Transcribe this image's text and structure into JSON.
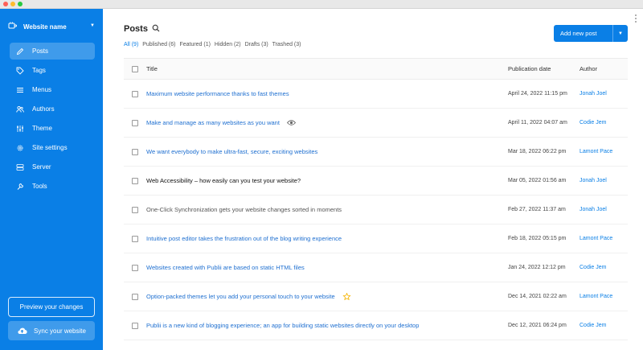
{
  "sidebar": {
    "site_name": "Website name",
    "items": [
      {
        "label": "Posts",
        "icon": "pen-icon",
        "active": true
      },
      {
        "label": "Tags",
        "icon": "tag-icon",
        "active": false
      },
      {
        "label": "Menus",
        "icon": "menu-icon",
        "active": false
      },
      {
        "label": "Authors",
        "icon": "users-icon",
        "active": false
      },
      {
        "label": "Theme",
        "icon": "sliders-icon",
        "active": false
      },
      {
        "label": "Site settings",
        "icon": "gear-icon",
        "active": false
      },
      {
        "label": "Server",
        "icon": "server-icon",
        "active": false
      },
      {
        "label": "Tools",
        "icon": "wrench-icon",
        "active": false
      }
    ],
    "preview_label": "Preview your changes",
    "sync_label": "Sync your website"
  },
  "main": {
    "title": "Posts",
    "filters": [
      {
        "label": "All (9)",
        "active": true
      },
      {
        "label": "Published (6)",
        "active": false
      },
      {
        "label": "Featured (1)",
        "active": false
      },
      {
        "label": "Hidden (2)",
        "active": false
      },
      {
        "label": "Drafts (3)",
        "active": false
      },
      {
        "label": "Trashed (3)",
        "active": false
      }
    ],
    "add_button_label": "Add new post",
    "columns": {
      "title": "Title",
      "date": "Publication date",
      "author": "Author"
    },
    "posts": [
      {
        "title": "Maximum website performance thanks to fast themes",
        "date": "April 24, 2022 11:15 pm",
        "author": "Jonah Joel",
        "style": "published",
        "badge": ""
      },
      {
        "title": "Make and manage as many websites as you want",
        "date": "April 11, 2022 04:07 am",
        "author": "Codie Jem",
        "style": "published",
        "badge": "eye-icon"
      },
      {
        "title": "We want everybody to make ultra-fast, secure, exciting websites",
        "date": "Mar 18, 2022 06:22 pm",
        "author": "Lamont Pace",
        "style": "published",
        "badge": ""
      },
      {
        "title": "Web Accessibility – how easily can you test your website?",
        "date": "Mar 05, 2022 01:56 am",
        "author": "Jonah Joel",
        "style": "hidden",
        "badge": ""
      },
      {
        "title": "One-Click Synchronization gets your website changes sorted in moments",
        "date": "Feb 27, 2022 11:37 am",
        "author": "Jonah Joel",
        "style": "draft",
        "badge": ""
      },
      {
        "title": "Intuitive post editor takes the frustration out of the blog writing experience",
        "date": "Feb 18, 2022 05:15 pm",
        "author": "Lamont Pace",
        "style": "published",
        "badge": ""
      },
      {
        "title": "Websites created with Publii are based on static HTML files",
        "date": "Jan 24, 2022 12:12 pm",
        "author": "Codie Jem",
        "style": "published",
        "badge": ""
      },
      {
        "title": "Option-packed themes let you add your personal touch to your website",
        "date": "Dec 14, 2021 02:22 am",
        "author": "Lamont Pace",
        "style": "published",
        "badge": "star-icon"
      },
      {
        "title": "Publii is a new kind of blogging experience; an app for building static websites directly on your desktop",
        "date": "Dec 12, 2021 06:24 pm",
        "author": "Codie Jem",
        "style": "published",
        "badge": ""
      }
    ]
  },
  "colors": {
    "sidebar_bg": "#0a7fe6",
    "link": "#1e6fd0",
    "star": "#f5b400"
  }
}
